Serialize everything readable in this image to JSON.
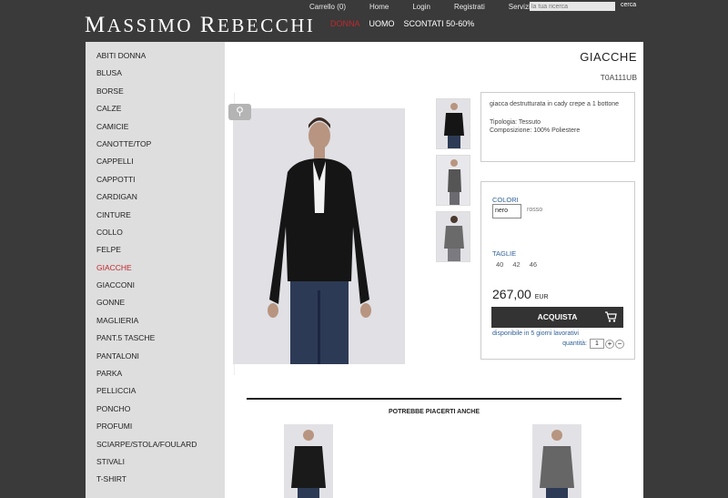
{
  "header": {
    "logo": "Massimo Rebecchi",
    "logo_first_initial": "M",
    "logo_first_rest": "ASSIMO",
    "logo_second_initial": "R",
    "logo_second_rest": "EBECCHI",
    "top_links": [
      "Carrello (0)",
      "Home",
      "Login",
      "Registrati",
      "Servizio Clienti"
    ],
    "search_placeholder": "la tua ricerca",
    "search_button": "cerca",
    "main_nav": [
      "DONNA",
      "UOMO",
      "SCONTATI 50-60%"
    ]
  },
  "sidebar": {
    "items": [
      "ABITI DONNA",
      "BLUSA",
      "BORSE",
      "CALZE",
      "CAMICIE",
      "CANOTTE/TOP",
      "CAPPELLI",
      "CAPPOTTI",
      "CARDIGAN",
      "CINTURE",
      "COLLO",
      "FELPE",
      "GIACCHE",
      "GIACCONI",
      "GONNE",
      "MAGLIERIA",
      "PANT.5 TASCHE",
      "PANTALONI",
      "PARKA",
      "PELLICCIA",
      "PONCHO",
      "PROFUMI",
      "SCIARPE/STOLA/FOULARD",
      "STIVALI",
      "T-SHIRT"
    ],
    "active": "GIACCHE"
  },
  "product": {
    "category_title": "GIACCHE",
    "code": "T0A111UB",
    "description": "giacca destrutturata in cady crepe a 1 bottone",
    "tipologia": "Tipologia: Tessuto",
    "composizione": "Composizione: 100% Poliestere",
    "colors_label": "COLORI",
    "color_selected": "nero",
    "color_other": "rosso",
    "sizes_label": "TAGLIE",
    "sizes": [
      "40",
      "42",
      "46"
    ],
    "price": "267,00",
    "currency": "EUR",
    "buy_button": "ACQUISTA",
    "availability": "disponibile in 5 giorni lavorativi",
    "quantity_label": "quantità:",
    "quantity": "1",
    "plus": "+",
    "minus": "−"
  },
  "suggestions": {
    "title": "POTREBBE PIACERTI ANCHE"
  },
  "colors": {
    "accent_red": "#c0282d",
    "link_blue": "#2f5f97",
    "dark_bg": "#3a3a3a"
  }
}
